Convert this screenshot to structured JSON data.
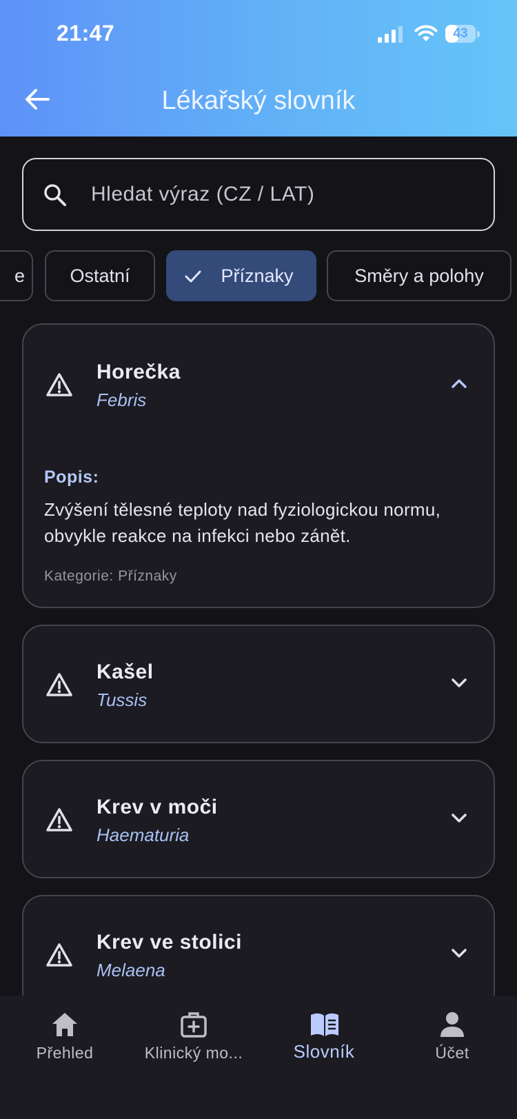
{
  "status_bar": {
    "time": "21:47",
    "battery": "43",
    "battery_level": 0.43
  },
  "app_bar": {
    "title": "Lékařský slovník",
    "back_icon": "arrow-left-icon"
  },
  "search": {
    "placeholder": "Hledat výraz (CZ / LAT)",
    "value": ""
  },
  "chips": [
    {
      "label": "e",
      "selected": false
    },
    {
      "label": "Ostatní",
      "selected": false
    },
    {
      "label": "Příznaky",
      "selected": true
    },
    {
      "label": "Směry a polohy",
      "selected": false
    }
  ],
  "entries": [
    {
      "title": "Horečka",
      "latin": "Febris",
      "expanded": true,
      "description_label": "Popis:",
      "description": "Zvýšení tělesné teploty nad fyziologickou normu, obvykle reakce na infekci nebo zánět.",
      "category": "Kategorie: Příznaky"
    },
    {
      "title": "Kašel",
      "latin": "Tussis",
      "expanded": false
    },
    {
      "title": "Krev v moči",
      "latin": "Haematuria",
      "expanded": false
    },
    {
      "title": "Krev ve stolici",
      "latin": "Melaena",
      "expanded": false
    }
  ],
  "bottom_nav": [
    {
      "label": "Přehled",
      "icon": "home-icon",
      "active": false
    },
    {
      "label": "Klinický mo...",
      "icon": "medical-kit-icon",
      "active": false
    },
    {
      "label": "Slovník",
      "icon": "book-icon",
      "active": true
    },
    {
      "label": "Účet",
      "icon": "person-icon",
      "active": false
    }
  ],
  "colors": {
    "header_gradient_start": "#5e92f8",
    "header_gradient_end": "#66c4f8",
    "background": "#131318",
    "selected_chip": "#344a78",
    "accent_text": "#a9c0f5",
    "active_nav": "#b9cbff"
  }
}
